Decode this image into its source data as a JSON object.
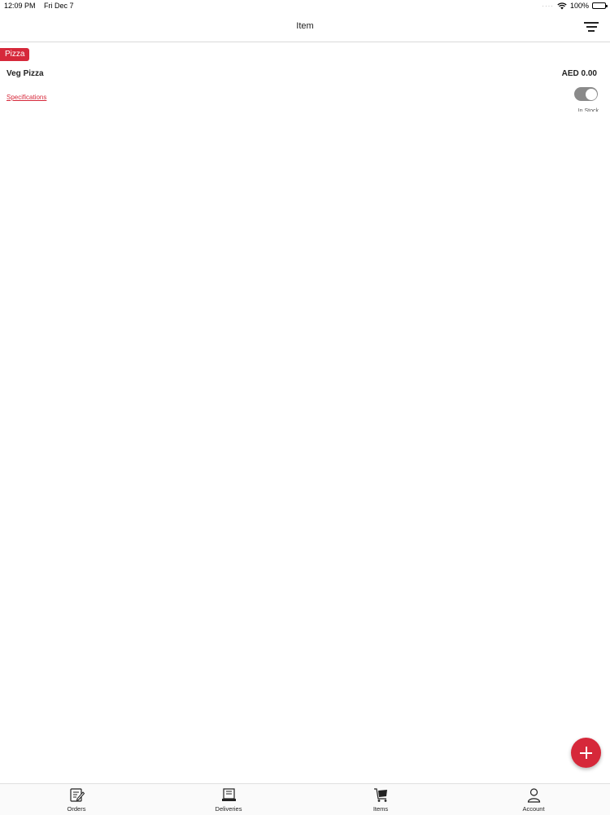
{
  "status_bar": {
    "time": "12:09 PM",
    "date": "Fri Dec 7",
    "battery": "100%",
    "icons": [
      "signal-dots-icon",
      "wifi-icon",
      "battery-icon"
    ]
  },
  "nav": {
    "title": "Item",
    "filter_icon": "filter-icon"
  },
  "item": {
    "category": "Pizza",
    "name": "Veg Pizza",
    "price": "AED 0.00",
    "specifications_link": "Specifications",
    "stock_label": "In Stock",
    "in_stock": true
  },
  "fab": {
    "icon": "plus-icon"
  },
  "tabs": [
    {
      "label": "Orders",
      "icon": "orders-icon"
    },
    {
      "label": "Deliveries",
      "icon": "deliveries-icon"
    },
    {
      "label": "Items",
      "icon": "items-cart-icon"
    },
    {
      "label": "Account",
      "icon": "account-icon"
    }
  ],
  "colors": {
    "accent": "#d6283a",
    "toggle_on": "#8a8a8a"
  }
}
